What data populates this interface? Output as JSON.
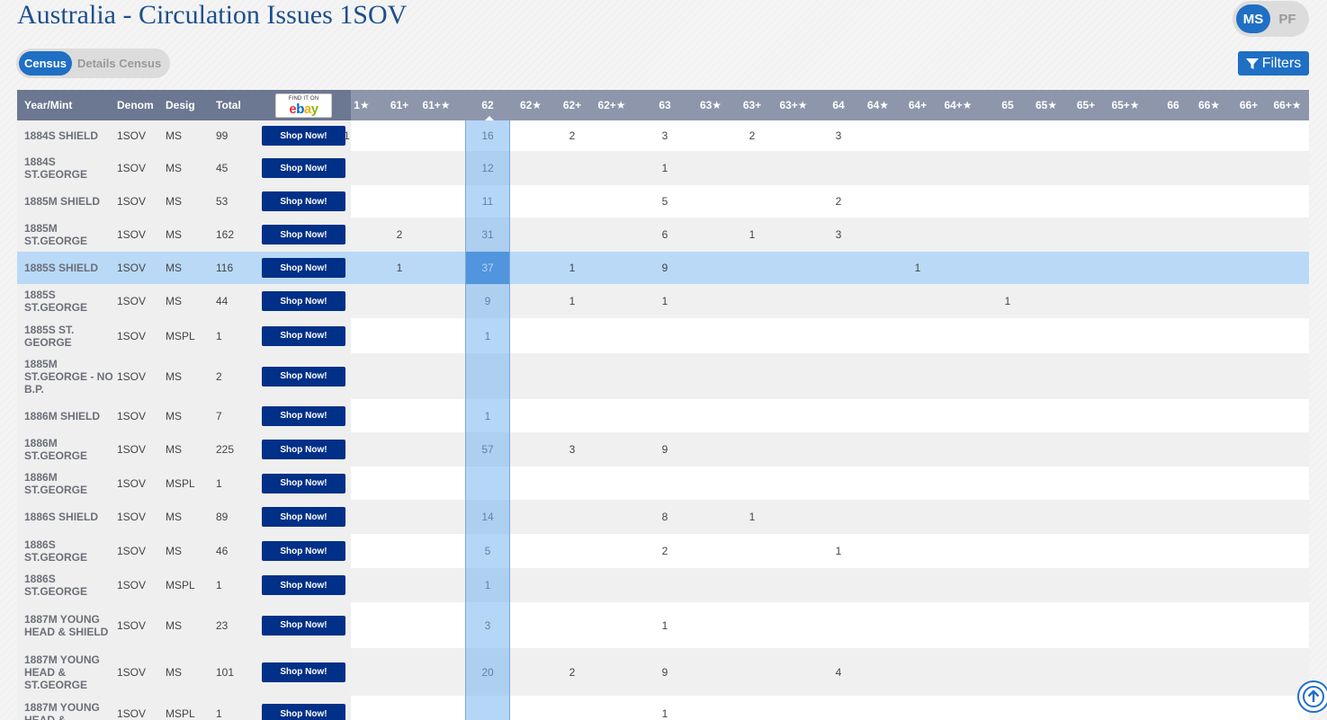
{
  "title": "Australia - Circulation Issues 1SOV",
  "designation_toggle": {
    "options": [
      "MS",
      "PF"
    ],
    "active": "MS"
  },
  "census_toggle": {
    "options": [
      "Census",
      "Details Census"
    ],
    "active": "Census"
  },
  "filters_label": "Filters",
  "columns": {
    "yearmint": "Year/Mint",
    "denom": "Denom",
    "desig": "Desig",
    "total": "Total"
  },
  "ebay": {
    "find_text": "FIND IT ON",
    "logo_text": "ebay"
  },
  "shop_label": "Shop Now!",
  "grade_columns": [
    "1★",
    "61+",
    "61+★",
    "62",
    "62★",
    "62+",
    "62+★",
    "63",
    "63★",
    "63+",
    "63+★",
    "64",
    "64★",
    "64+",
    "64+★",
    "65",
    "65★",
    "65+",
    "65+★",
    "66",
    "66★",
    "66+",
    "66+★"
  ],
  "highlight_grade": "62",
  "highlight_row": 4,
  "rows": [
    {
      "name": "1884S SHIELD",
      "denom": "1SOV",
      "desig": "MS",
      "total": "99",
      "grades": {
        "1★": "1",
        "62": "16",
        "62+": "2",
        "63": "3",
        "63+": "2",
        "64": "3"
      }
    },
    {
      "name": "1884S ST.GEORGE",
      "denom": "1SOV",
      "desig": "MS",
      "total": "45",
      "grades": {
        "62": "12",
        "63": "1"
      }
    },
    {
      "name": "1885M SHIELD",
      "denom": "1SOV",
      "desig": "MS",
      "total": "53",
      "grades": {
        "62": "11",
        "63": "5",
        "64": "2"
      }
    },
    {
      "name": "1885M ST.GEORGE",
      "denom": "1SOV",
      "desig": "MS",
      "total": "162",
      "grades": {
        "61+": "2",
        "62": "31",
        "63": "6",
        "63+": "1",
        "64": "3"
      }
    },
    {
      "name": "1885S SHIELD",
      "denom": "1SOV",
      "desig": "MS",
      "total": "116",
      "grades": {
        "61+": "1",
        "62": "37",
        "62+": "1",
        "63": "9",
        "64+": "1"
      }
    },
    {
      "name": "1885S ST.GEORGE",
      "denom": "1SOV",
      "desig": "MS",
      "total": "44",
      "grades": {
        "62": "9",
        "62+": "1",
        "63": "1",
        "65": "1"
      }
    },
    {
      "name": "1885S ST. GEORGE",
      "denom": "1SOV",
      "desig": "MSPL",
      "total": "1",
      "grades": {
        "62": "1"
      }
    },
    {
      "name": "1885M ST.GEORGE - NO B.P.",
      "denom": "1SOV",
      "desig": "MS",
      "total": "2",
      "grades": {}
    },
    {
      "name": "1886M SHIELD",
      "denom": "1SOV",
      "desig": "MS",
      "total": "7",
      "grades": {
        "62": "1"
      }
    },
    {
      "name": "1886M ST.GEORGE",
      "denom": "1SOV",
      "desig": "MS",
      "total": "225",
      "grades": {
        "62": "57",
        "62+": "3",
        "63": "9"
      }
    },
    {
      "name": "1886M ST.GEORGE",
      "denom": "1SOV",
      "desig": "MSPL",
      "total": "1",
      "grades": {}
    },
    {
      "name": "1886S SHIELD",
      "denom": "1SOV",
      "desig": "MS",
      "total": "89",
      "grades": {
        "62": "14",
        "63": "8",
        "63+": "1"
      }
    },
    {
      "name": "1886S ST.GEORGE",
      "denom": "1SOV",
      "desig": "MS",
      "total": "46",
      "grades": {
        "62": "5",
        "63": "2",
        "64": "1"
      }
    },
    {
      "name": "1886S ST.GEORGE",
      "denom": "1SOV",
      "desig": "MSPL",
      "total": "1",
      "grades": {
        "62": "1"
      }
    },
    {
      "name": "1887M YOUNG HEAD & SHIELD",
      "denom": "1SOV",
      "desig": "MS",
      "total": "23",
      "grades": {
        "62": "3",
        "63": "1"
      }
    },
    {
      "name": "1887M YOUNG HEAD & ST.GEORGE",
      "denom": "1SOV",
      "desig": "MS",
      "total": "101",
      "grades": {
        "62": "20",
        "62+": "2",
        "63": "9",
        "64": "4"
      }
    },
    {
      "name": "1887M YOUNG HEAD &",
      "denom": "1SOV",
      "desig": "MSPL",
      "total": "1",
      "grades": {
        "63": "1"
      }
    }
  ]
}
